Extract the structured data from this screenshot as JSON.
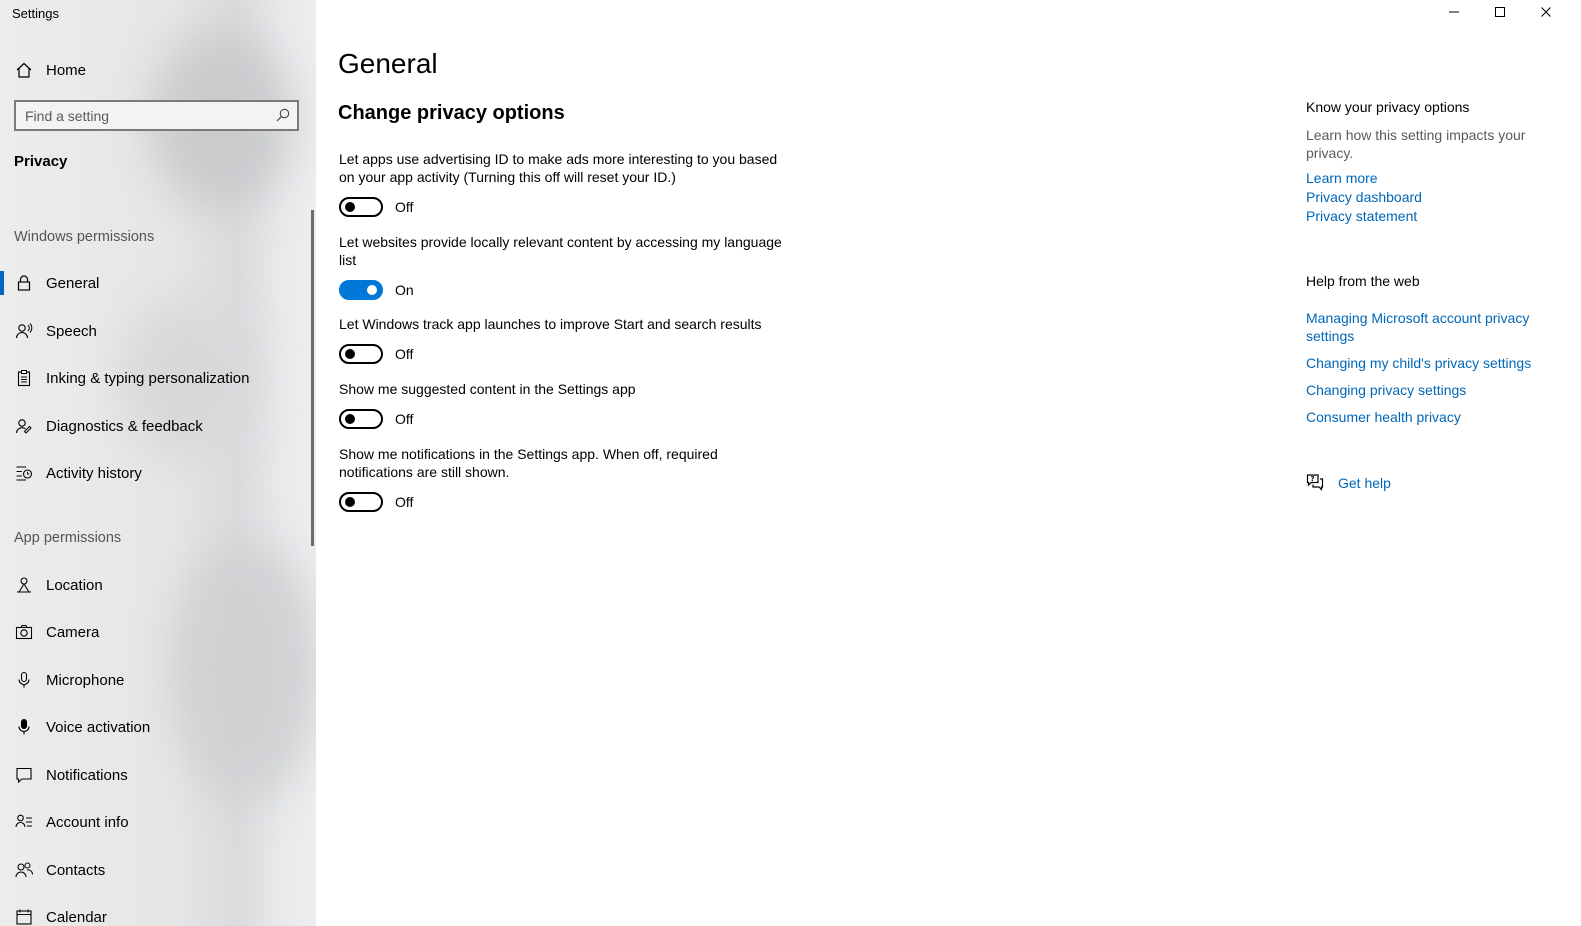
{
  "window": {
    "title": "Settings",
    "controls": [
      "minimize",
      "maximize",
      "close"
    ]
  },
  "sidebar": {
    "home_label": "Home",
    "search_placeholder": "Find a setting",
    "section_title": "Privacy",
    "windows_permissions_header": "Windows permissions",
    "windows_permissions": [
      {
        "label": "General",
        "icon": "lock-icon",
        "selected": true
      },
      {
        "label": "Speech",
        "icon": "speech-icon"
      },
      {
        "label": "Inking & typing personalization",
        "icon": "clipboard-icon"
      },
      {
        "label": "Diagnostics & feedback",
        "icon": "feedback-icon"
      },
      {
        "label": "Activity history",
        "icon": "activity-history-icon"
      }
    ],
    "app_permissions_header": "App permissions",
    "app_permissions": [
      {
        "label": "Location",
        "icon": "location-icon"
      },
      {
        "label": "Camera",
        "icon": "camera-icon"
      },
      {
        "label": "Microphone",
        "icon": "microphone-icon"
      },
      {
        "label": "Voice activation",
        "icon": "voice-activation-icon"
      },
      {
        "label": "Notifications",
        "icon": "notifications-icon"
      },
      {
        "label": "Account info",
        "icon": "account-info-icon"
      },
      {
        "label": "Contacts",
        "icon": "contacts-icon"
      },
      {
        "label": "Calendar",
        "icon": "calendar-icon"
      }
    ]
  },
  "main": {
    "title": "General",
    "subheading": "Change privacy options",
    "settings": [
      {
        "description": "Let apps use advertising ID to make ads more interesting to you based on your app activity (Turning this off will reset your ID.)",
        "state": "Off",
        "on": false
      },
      {
        "description": "Let websites provide locally relevant content by accessing my language list",
        "state": "On",
        "on": true
      },
      {
        "description": "Let Windows track app launches to improve Start and search results",
        "state": "Off",
        "on": false
      },
      {
        "description": "Show me suggested content in the Settings app",
        "state": "Off",
        "on": false
      },
      {
        "description": "Show me notifications in the Settings app. When off, required notifications are still shown.",
        "state": "Off",
        "on": false
      }
    ]
  },
  "aside": {
    "know_title": "Know your privacy options",
    "know_text": "Learn how this setting impacts your privacy.",
    "know_links": [
      "Learn more",
      "Privacy dashboard",
      "Privacy statement"
    ],
    "help_title": "Help from the web",
    "help_links": [
      "Managing Microsoft account privacy settings",
      "Changing my child's privacy settings",
      "Changing privacy settings",
      "Consumer health privacy"
    ],
    "get_help": "Get help"
  },
  "colors": {
    "accent": "#0078d7",
    "link": "#0067b8"
  }
}
